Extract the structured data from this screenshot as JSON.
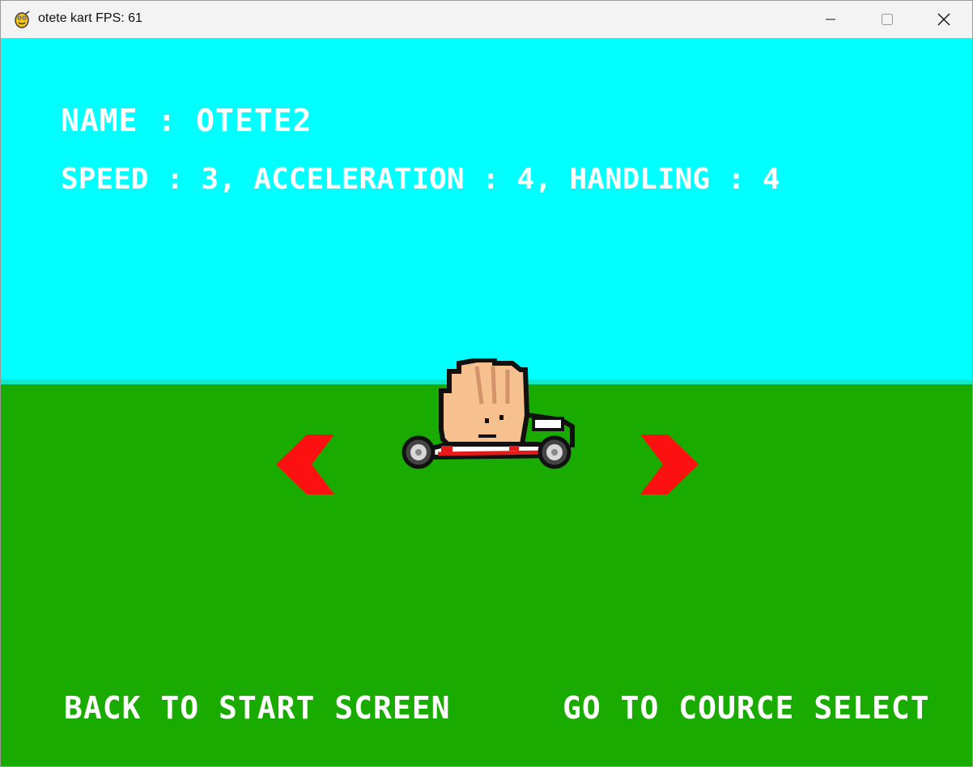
{
  "window": {
    "title": "otete kart FPS: 61",
    "icon": "pygame-snake-icon"
  },
  "controls": {
    "minimize_icon": "minimize-icon",
    "maximize_icon": "maximize-icon",
    "close_icon": "close-icon"
  },
  "scene": {
    "sky_color": "#00ffff",
    "horizon_color": "#12e8c8",
    "ground_color": "#1aab00",
    "arrow_color": "#ff1010"
  },
  "character": {
    "name_line": "NAME : OTETE2",
    "stats_line": "SPEED : 3, ACCELERATION : 4, HANDLING : 4"
  },
  "buttons": {
    "back": "BACK TO START SCREEN",
    "go": "GO TO COURCE SELECT",
    "prev_icon": "left-arrow-icon",
    "next_icon": "right-arrow-icon"
  }
}
